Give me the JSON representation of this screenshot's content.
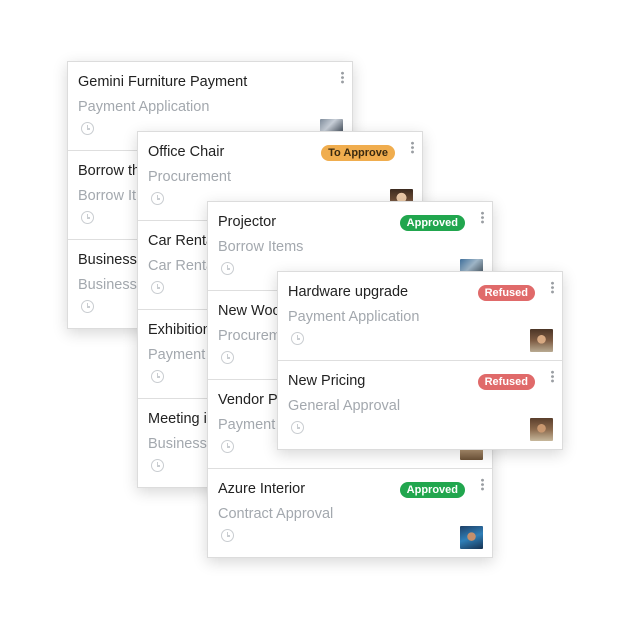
{
  "columns": [
    {
      "cards": [
        {
          "title": "Gemini Furniture Payment",
          "subtitle": "Payment Application"
        },
        {
          "title": "Borrow th",
          "subtitle": "Borrow It"
        },
        {
          "title": "Business",
          "subtitle": "Business"
        }
      ]
    },
    {
      "cards": [
        {
          "title": "Office Chair",
          "subtitle": "Procurement",
          "badge": "To Approve"
        },
        {
          "title": "Car Renta",
          "subtitle": "Car Renta"
        },
        {
          "title": "Exhibition",
          "subtitle": "Payment"
        },
        {
          "title": "Meeting i",
          "subtitle": "Business"
        }
      ]
    },
    {
      "cards": [
        {
          "title": "Projector",
          "subtitle": "Borrow Items",
          "badge": "Approved"
        },
        {
          "title": "New Woo",
          "subtitle": "Procurem"
        },
        {
          "title": "Vendor P",
          "subtitle": "Payment"
        },
        {
          "title": "Azure Interior",
          "subtitle": "Contract Approval",
          "badge": "Approved"
        }
      ]
    },
    {
      "cards": [
        {
          "title": "Hardware upgrade",
          "subtitle": "Payment Application",
          "badge": "Refused"
        },
        {
          "title": "New Pricing",
          "subtitle": "General Approval",
          "badge": "Refused"
        }
      ]
    }
  ],
  "icons": {
    "clock": "clock-icon",
    "menu": "kebab-menu-icon"
  },
  "colors": {
    "to_approve": "#f0ad4e",
    "approved": "#21a64e",
    "refused": "#e06a6a",
    "subtitle": "#a3a8ae"
  }
}
